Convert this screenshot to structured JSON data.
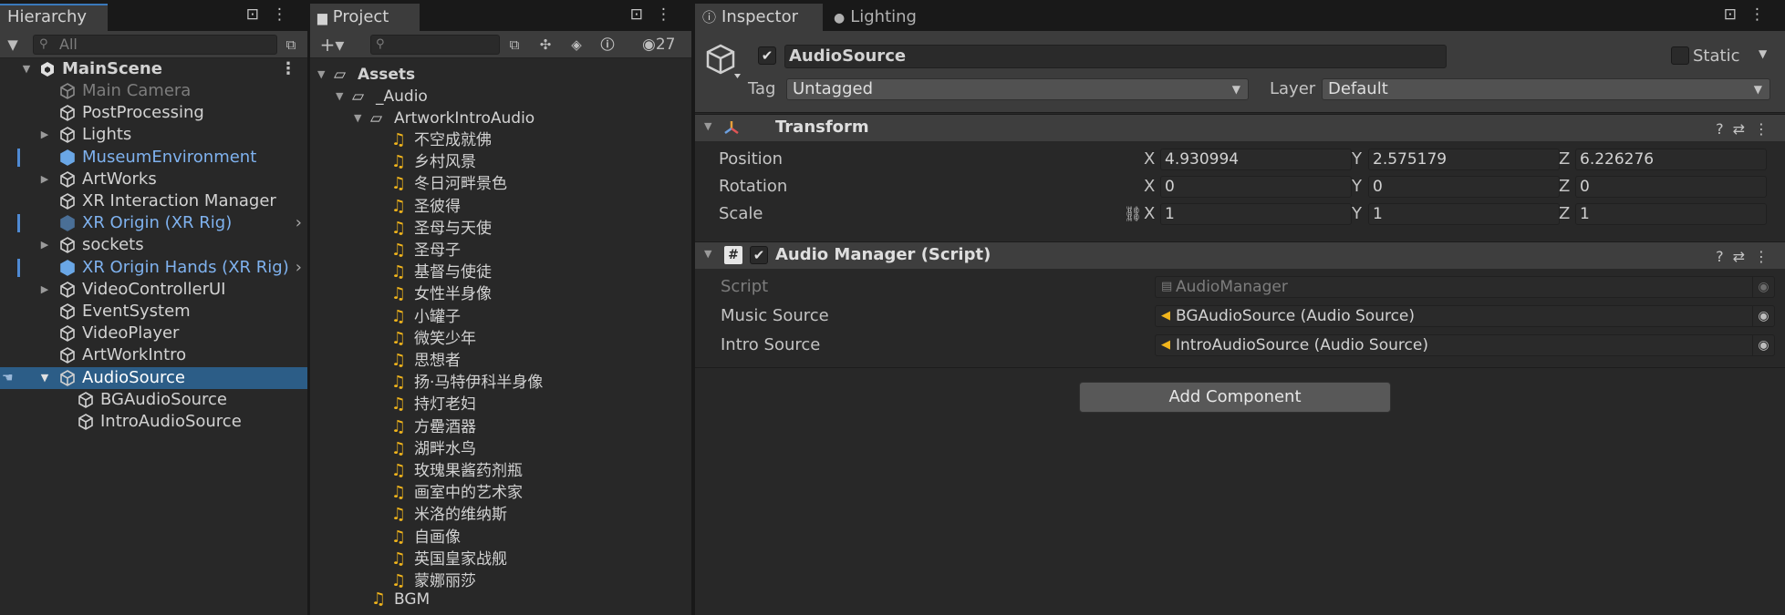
{
  "hierarchy": {
    "tab_label": "Hierarchy",
    "search_placeholder": "All",
    "scene": "MainScene",
    "items": [
      {
        "label": "Main Camera",
        "state": "disabled",
        "icon": "cube-icon"
      },
      {
        "label": "PostProcessing",
        "icon": "cube-icon"
      },
      {
        "label": "Lights",
        "icon": "cube-icon",
        "expandable": true
      },
      {
        "label": "MuseumEnvironment",
        "icon": "prefab-icon",
        "prefab": true
      },
      {
        "label": "ArtWorks",
        "icon": "cube-icon",
        "expandable": true
      },
      {
        "label": "XR Interaction Manager",
        "icon": "cube-icon"
      },
      {
        "label": "XR Origin (XR Rig)",
        "icon": "prefab-icon",
        "prefab": true,
        "disabled": true
      },
      {
        "label": "sockets",
        "icon": "cube-icon",
        "expandable": true
      },
      {
        "label": "XR Origin Hands (XR Rig)",
        "icon": "prefab-icon",
        "prefab": true
      },
      {
        "label": "VideoControllerUI",
        "icon": "cube-icon",
        "expandable": true
      },
      {
        "label": "EventSystem",
        "icon": "cube-icon"
      },
      {
        "label": "VideoPlayer",
        "icon": "cube-icon"
      },
      {
        "label": "ArtWorkIntro",
        "icon": "cube-icon"
      },
      {
        "label": "AudioSource",
        "icon": "cube-icon",
        "selected": true,
        "expanded": true
      },
      {
        "label": "BGAudioSource",
        "icon": "cube-icon",
        "child": true
      },
      {
        "label": "IntroAudioSource",
        "icon": "cube-icon",
        "child": true
      }
    ]
  },
  "project": {
    "tab_label": "Project",
    "hidden_count": "27",
    "root": "Assets",
    "folder1": "_Audio",
    "folder2": "ArtworkIntroAudio",
    "clips": [
      "不空成就佛",
      "乡村风景",
      "冬日河畔景色",
      "圣彼得",
      "圣母与天使",
      "圣母子",
      "基督与使徒",
      "女性半身像",
      "小罐子",
      "微笑少年",
      "思想者",
      "扬·马特伊科半身像",
      "持灯老妇",
      "方罍酒器",
      "湖畔水鸟",
      "玫瑰果酱药剂瓶",
      "画室中的艺术家",
      "米洛的维纳斯",
      "自画像",
      "英国皇家战舰",
      "蒙娜丽莎"
    ],
    "bgm": "BGM"
  },
  "inspector": {
    "tab_label": "Inspector",
    "tab2_label": "Lighting",
    "object_name": "AudioSource",
    "static_label": "Static",
    "tag_label": "Tag",
    "tag_value": "Untagged",
    "layer_label": "Layer",
    "layer_value": "Default",
    "transform": {
      "title": "Transform",
      "position_label": "Position",
      "rotation_label": "Rotation",
      "scale_label": "Scale",
      "position": {
        "x": "4.930994",
        "y": "2.575179",
        "z": "6.226276"
      },
      "rotation": {
        "x": "0",
        "y": "0",
        "z": "0"
      },
      "scale": {
        "x": "1",
        "y": "1",
        "z": "1"
      },
      "axis_x": "X",
      "axis_y": "Y",
      "axis_z": "Z"
    },
    "audio_manager": {
      "title": "Audio Manager (Script)",
      "script_label": "Script",
      "script_value": "AudioManager",
      "music_label": "Music Source",
      "music_value": "BGAudioSource (Audio Source)",
      "intro_label": "Intro Source",
      "intro_value": "IntroAudioSource (Audio Source)"
    },
    "add_component": "Add Component"
  },
  "colors": {
    "selection": "#2c5d87",
    "prefab_text": "#7fb2ef",
    "audio_icon": "#f1b51c",
    "tab_underline": "#3a79bb"
  }
}
